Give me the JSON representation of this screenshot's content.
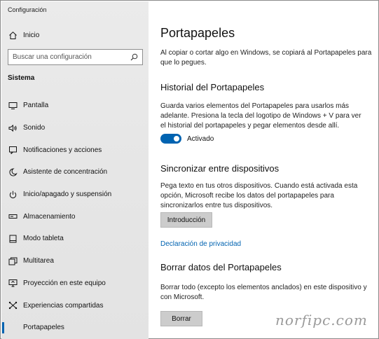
{
  "window": {
    "title": "Configuración"
  },
  "sidebar": {
    "home_label": "Inicio",
    "search_placeholder": "Buscar una configuración",
    "section_title": "Sistema",
    "items": [
      {
        "label": "Pantalla",
        "icon": "monitor-icon"
      },
      {
        "label": "Sonido",
        "icon": "speaker-icon"
      },
      {
        "label": "Notificaciones y acciones",
        "icon": "notification-icon"
      },
      {
        "label": "Asistente de concentración",
        "icon": "moon-icon"
      },
      {
        "label": "Inicio/apagado y suspensión",
        "icon": "power-icon"
      },
      {
        "label": "Almacenamiento",
        "icon": "storage-icon"
      },
      {
        "label": "Modo tableta",
        "icon": "tablet-icon"
      },
      {
        "label": "Multitarea",
        "icon": "multitask-icon"
      },
      {
        "label": "Proyección en este equipo",
        "icon": "projection-icon"
      },
      {
        "label": "Experiencias compartidas",
        "icon": "shared-icon"
      },
      {
        "label": "Portapapeles",
        "icon": "clipboard-icon",
        "selected": true
      }
    ]
  },
  "main": {
    "title": "Portapapeles",
    "intro": [
      "Al copiar o cortar algo en Windows, se copiará al Portapapeles para",
      "que lo pegues."
    ],
    "history": {
      "heading": "Historial del Portapapeles",
      "text": [
        "Guarda varios elementos del Portapapeles para usarlos más",
        "adelante. Presiona la tecla del logotipo de Windows + V para ver",
        "el historial del portapapeles y pegar elementos desde allí."
      ],
      "toggle_label": "Activado",
      "toggle_on": true
    },
    "sync": {
      "heading": "Sincronizar entre dispositivos",
      "text": [
        "Pega texto en tus otros dispositivos. Cuando está activada esta",
        "opción, Microsoft recibe los datos del portapapeles para",
        "sincronizarlos entre tus dispositivos."
      ],
      "button_label": "Introducción"
    },
    "privacy_link": "Declaración de privacidad",
    "clear": {
      "heading": "Borrar datos del Portapapeles",
      "text": [
        "Borrar todo (excepto los elementos anclados) en este dispositivo y",
        "con Microsoft."
      ],
      "button_label": "Borrar"
    }
  },
  "watermark": "norfipc.com",
  "colors": {
    "accent": "#0063b1",
    "sidebar_bg": "#e6e6e6",
    "button_bg": "#cccccc"
  }
}
